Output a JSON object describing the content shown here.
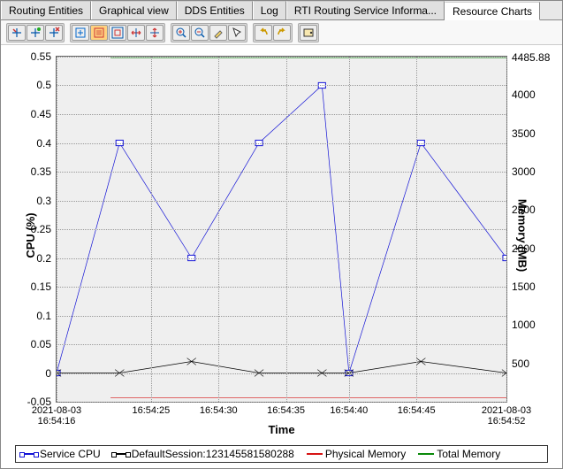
{
  "tabs": [
    {
      "label": "Routing Entities",
      "active": false
    },
    {
      "label": "Graphical view",
      "active": false
    },
    {
      "label": "DDS Entities",
      "active": false
    },
    {
      "label": "Log",
      "active": false
    },
    {
      "label": "RTI Routing Service Informa...",
      "active": false
    },
    {
      "label": "Resource Charts",
      "active": true
    }
  ],
  "axes": {
    "xlabel": "Time",
    "ylabel_left": "CPU (%)",
    "ylabel_right": "Memory (MB)"
  },
  "chart_data": {
    "type": "line",
    "x_categories": [
      "2021-08-03\n16:54:16",
      "16:54:25",
      "16:54:30",
      "16:54:35",
      "16:54:40",
      "16:54:45",
      "2021-08-03\n16:54:52"
    ],
    "x_positions": [
      0,
      0.21,
      0.36,
      0.51,
      0.65,
      0.8,
      1.0
    ],
    "y_left": {
      "min": -0.05,
      "max": 0.55,
      "ticks": [
        -0.05,
        0,
        0.05,
        0.1,
        0.15,
        0.2,
        0.25,
        0.3,
        0.35,
        0.4,
        0.45,
        0.5,
        0.55
      ]
    },
    "y_right": {
      "min": 0,
      "max": 4500,
      "ticks": [
        500,
        1000,
        1500,
        2000,
        2500,
        3000,
        3500,
        4000
      ],
      "extra_tick": 4485.88
    },
    "series": [
      {
        "name": "Service CPU",
        "color": "#1414d6",
        "marker": "square",
        "axis": "left",
        "points": [
          [
            0,
            0
          ],
          [
            0.14,
            0.4
          ],
          [
            0.3,
            0.2
          ],
          [
            0.45,
            0.4
          ],
          [
            0.59,
            0.5
          ],
          [
            0.65,
            0.0
          ],
          [
            0.81,
            0.4
          ],
          [
            1.0,
            0.2
          ]
        ]
      },
      {
        "name": "DefaultSession:123145581580288",
        "color": "#000000",
        "marker": "x",
        "axis": "left",
        "points": [
          [
            0,
            0.0
          ],
          [
            0.14,
            0.0
          ],
          [
            0.3,
            0.02
          ],
          [
            0.45,
            0.0
          ],
          [
            0.59,
            0.0
          ],
          [
            0.65,
            0.0
          ],
          [
            0.81,
            0.02
          ],
          [
            1.0,
            0.0
          ]
        ]
      },
      {
        "name": "Physical Memory",
        "color": "#d61414",
        "marker": null,
        "axis": "right",
        "points": [
          [
            0.12,
            50
          ],
          [
            1.0,
            50
          ]
        ]
      },
      {
        "name": "Total Memory",
        "color": "#0a8a0a",
        "marker": null,
        "axis": "right",
        "points": [
          [
            0.12,
            4485.88
          ],
          [
            1.0,
            4485.88
          ]
        ]
      }
    ]
  },
  "legend": [
    {
      "label": "Service CPU",
      "color": "#1414d6",
      "marker": true
    },
    {
      "label": "DefaultSession:123145581580288",
      "color": "#000000",
      "marker": true
    },
    {
      "label": "Physical Memory",
      "color": "#d61414",
      "marker": false
    },
    {
      "label": "Total Memory",
      "color": "#0a8a0a",
      "marker": false
    }
  ],
  "toolbar_icons": [
    "edit-crosshair",
    "add-crosshair",
    "remove-crosshair",
    "select-scroll",
    "select-area",
    "zoom-fit",
    "zoom-h",
    "zoom-v",
    "zoom-in",
    "zoom-out",
    "eyedropper",
    "pointer",
    "undo",
    "redo",
    "settings"
  ]
}
